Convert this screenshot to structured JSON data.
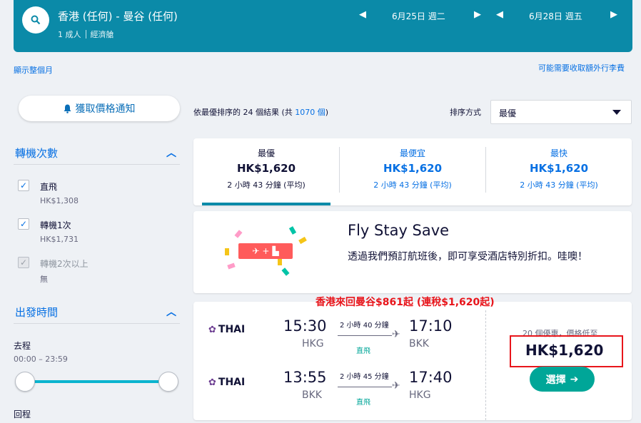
{
  "header": {
    "route": "香港 (任何) - 曼谷 (任何)",
    "passengers": "1 成人",
    "cabin": "經濟艙",
    "depart_date": "6月25日 週二",
    "return_date": "6月28日 週五",
    "arrow_left": "◀",
    "arrow_right": "▶"
  },
  "links": {
    "show_month": "顯示整個月",
    "extra_fees": "可能需要收取額外行李費"
  },
  "sidebar": {
    "alert_button": "獲取價格通知",
    "stops": {
      "title": "轉機次數",
      "options": [
        {
          "label": "直飛",
          "price": "HK$1,308",
          "checked": true,
          "disabled": false
        },
        {
          "label": "轉機1次",
          "price": "HK$1,731",
          "checked": true,
          "disabled": false
        },
        {
          "label": "轉機2次以上",
          "price": "無",
          "checked": true,
          "disabled": true
        }
      ]
    },
    "times": {
      "title": "出發時間",
      "outbound_label": "去程",
      "outbound_range": "00:00 – 23:59",
      "return_label": "回程"
    }
  },
  "results": {
    "summary_prefix": "依最優排序的 24 個結果 (共 ",
    "total": "1070 個",
    "summary_suffix": ")",
    "sort_label": "排序方式",
    "sort_value": "最優"
  },
  "tabs": [
    {
      "label": "最優",
      "price": "HK$1,620",
      "duration": "2 小時 43 分鐘 (平均)",
      "active": true
    },
    {
      "label": "最便宜",
      "price": "HK$1,620",
      "duration": "2 小時 43 分鐘 (平均)",
      "active": false
    },
    {
      "label": "最快",
      "price": "HK$1,620",
      "duration": "2 小時 43 分鐘 (平均)",
      "active": false
    }
  ],
  "promo": {
    "title": "Fly Stay Save",
    "text": "透過我們預訂航班後，即可享受酒店特別折扣。哇噢！",
    "badge_plus": "+"
  },
  "overlay_caption": "香港來回曼谷$861起 (連稅$1,620起)",
  "flight": {
    "outbound": {
      "airline": "THAI",
      "dep_time": "15:30",
      "dep_code": "HKG",
      "duration": "2 小時 40 分鐘",
      "stops": "直飛",
      "arr_time": "17:10",
      "arr_code": "BKK"
    },
    "inbound": {
      "airline": "THAI",
      "dep_time": "13:55",
      "dep_code": "BKK",
      "duration": "2 小時 45 分鐘",
      "stops": "直飛",
      "arr_time": "17:40",
      "arr_code": "HKG"
    },
    "deals": "20 個優惠，價格低至",
    "price": "HK$1,620",
    "select_label": "選擇"
  },
  "colors": {
    "header_bg": "#0b8aa8",
    "link": "#0770e3",
    "select_btn": "#00a698",
    "highlight_red": "#e8151b"
  }
}
